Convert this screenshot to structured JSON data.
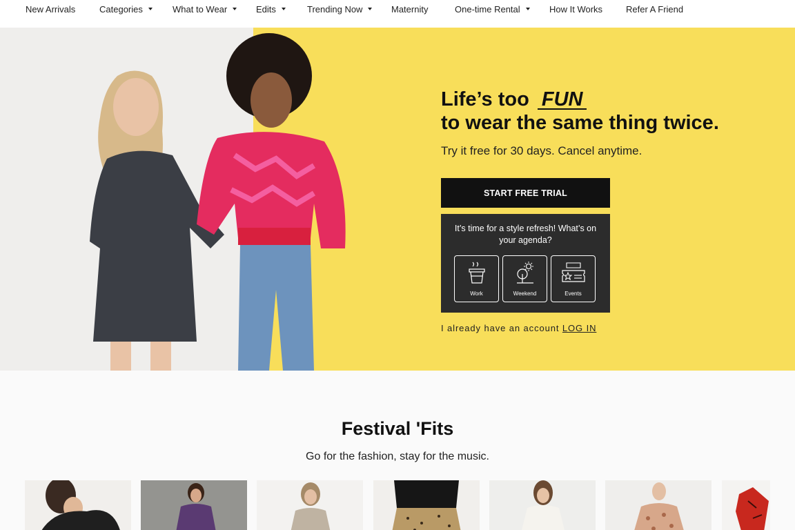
{
  "nav": {
    "items": [
      {
        "label": "New Arrivals",
        "dropdown": false
      },
      {
        "label": "Categories",
        "dropdown": true
      },
      {
        "label": "What to Wear",
        "dropdown": true
      },
      {
        "label": "Edits",
        "dropdown": true
      },
      {
        "label": "Trending Now",
        "dropdown": true
      },
      {
        "label": "Maternity",
        "dropdown": false
      },
      {
        "label": "One-time Rental",
        "dropdown": true
      },
      {
        "label": "How It Works",
        "dropdown": false
      },
      {
        "label": "Refer A Friend",
        "dropdown": false
      }
    ]
  },
  "hero": {
    "headline_prefix": "Life’s too",
    "headline_accent": "FUN",
    "headline_line2": "to wear the same thing twice.",
    "subhead": "Try it free for 30 days. Cancel anytime.",
    "cta_label": "START FREE TRIAL",
    "quiz": {
      "question": "It’s time for a style refresh! What’s on your agenda?",
      "options": [
        {
          "label": "Work",
          "icon": "coffee-cup-icon"
        },
        {
          "label": "Weekend",
          "icon": "tree-sun-icon"
        },
        {
          "label": "Events",
          "icon": "ticket-icon"
        }
      ]
    },
    "login_prompt": "I already have an account",
    "login_link": "LOG IN",
    "colors": {
      "accent_bg": "#f8de5a",
      "photo_bg": "#efeeec",
      "cta_bg": "#111111",
      "quiz_bg": "#2c2c2c"
    }
  },
  "festival": {
    "title": "Festival 'Fits",
    "subtitle": "Go for the fashion, stay for the music."
  }
}
